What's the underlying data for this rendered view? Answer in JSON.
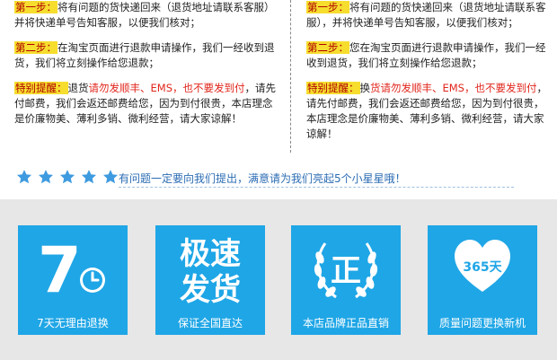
{
  "left_column": {
    "step1": {
      "label": "第一步：",
      "text": "将有问题的货快递回来（退货地址请联系客服）并将快递单号告知客服，以便我们核对；"
    },
    "step2": {
      "label": "第二步：",
      "text": "在淘宝页面进行退款申请操作，我们一经收到退货，我们将立刻操作给您退款；"
    },
    "notice": {
      "label": "特别提醒：",
      "pre": "退货",
      "red": "请勿发顺丰、EMS，也不要发到付",
      "post": "，请先付邮费，我们会返还邮费给您，因为到付很贵，本店理念是价廉物美、薄利多销、微利经营，请大家谅解！"
    }
  },
  "right_column": {
    "step1": {
      "label": "第一步：",
      "text": "将有问题的货快递回来（退货地址请联系客服），并将快递单号告知客服，以便我们核对；"
    },
    "step2": {
      "label": "第二步：",
      "text": "您在淘宝页面进行退款申请操作，我们一经收到退货，我们将立刻操作给您退款；"
    },
    "notice": {
      "label": "特别提醒：",
      "pre": "换",
      "red": "货请勿发顺丰、EMS，也不要发到付",
      "post": "，请先付邮费，我们会返还邮费给您，因为到付很贵，本店理念是价廉物美、薄利多销、微利经营，请大家谅解！"
    }
  },
  "rating": {
    "stars": 5,
    "text": "有问题一定要向我们提出，满意请为我们亮起5个小星星哦！",
    "star_color": "#3f9be0"
  },
  "cards": [
    {
      "icon": "7-day-clock-icon",
      "number": "7",
      "caption": "7天无理由退换"
    },
    {
      "icon": "fast-delivery-icon",
      "line1": "极速",
      "line2": "发货",
      "caption": "保证全国直达"
    },
    {
      "icon": "genuine-laurel-icon",
      "glyph": "正",
      "caption": "本店品牌正品直销"
    },
    {
      "icon": "365-heart-icon",
      "badge": "365天",
      "caption": "质量问题更换新机"
    }
  ],
  "colors": {
    "accent_blue": "#1fa6e6",
    "highlight_yellow": "#f6dd2e",
    "alert_red": "#e1251b",
    "band_gray": "#e7e7e7"
  }
}
